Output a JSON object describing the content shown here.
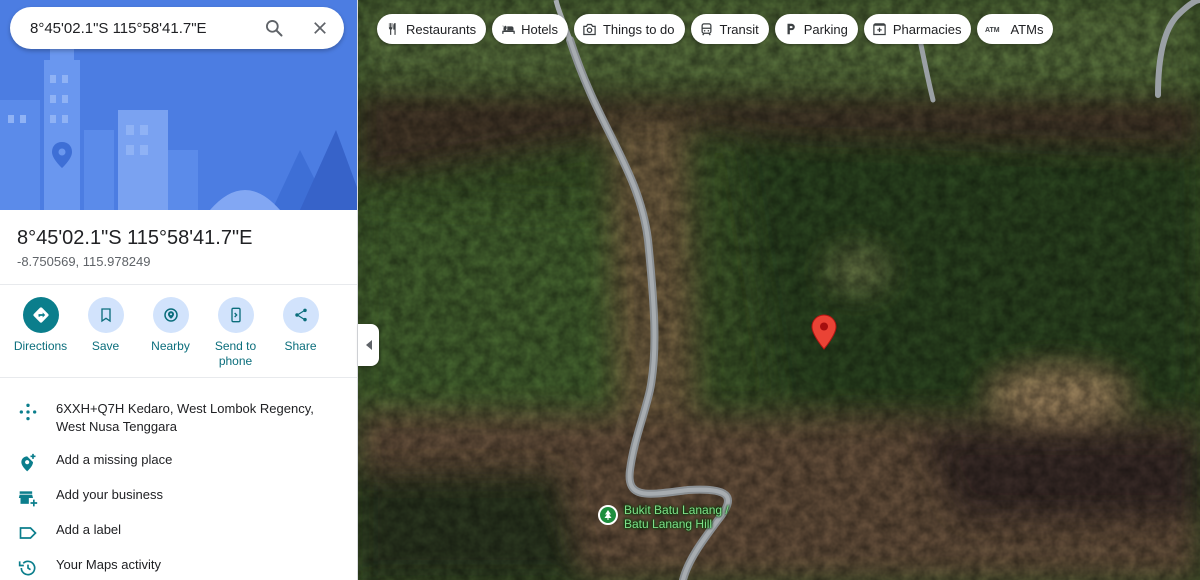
{
  "search": {
    "value": "8°45'02.1\"S 115°58'41.7\"E",
    "search_icon": "search-icon",
    "close_icon": "close-icon"
  },
  "place": {
    "title": "8°45'02.1\"S 115°58'41.7\"E",
    "decimal": "-8.750569, 115.978249"
  },
  "actions": [
    {
      "label": "Directions",
      "icon": "directions-icon"
    },
    {
      "label": "Save",
      "icon": "bookmark-icon"
    },
    {
      "label": "Nearby",
      "icon": "nearby-icon"
    },
    {
      "label": "Send to phone",
      "icon": "send-to-phone-icon"
    },
    {
      "label": "Share",
      "icon": "share-icon"
    }
  ],
  "info": {
    "plus_code": "6XXH+Q7H Kedaro, West Lombok Regency, West Nusa Tenggara",
    "add_missing_place": "Add a missing place",
    "add_business": "Add your business",
    "add_label": "Add a label",
    "maps_activity": "Your Maps activity"
  },
  "chips": [
    {
      "label": "Restaurants",
      "icon": "restaurant-icon"
    },
    {
      "label": "Hotels",
      "icon": "hotel-icon"
    },
    {
      "label": "Things to do",
      "icon": "camera-icon"
    },
    {
      "label": "Transit",
      "icon": "transit-icon"
    },
    {
      "label": "Parking",
      "icon": "parking-icon"
    },
    {
      "label": "Pharmacies",
      "icon": "pharmacy-icon"
    },
    {
      "label": "ATMs",
      "icon": "atm-icon"
    }
  ],
  "map": {
    "poi_label": "Bukit Batu Lanang / Batu Lanang Hill",
    "pin_color": "#ea4335",
    "accent": "#0b7e8c"
  }
}
